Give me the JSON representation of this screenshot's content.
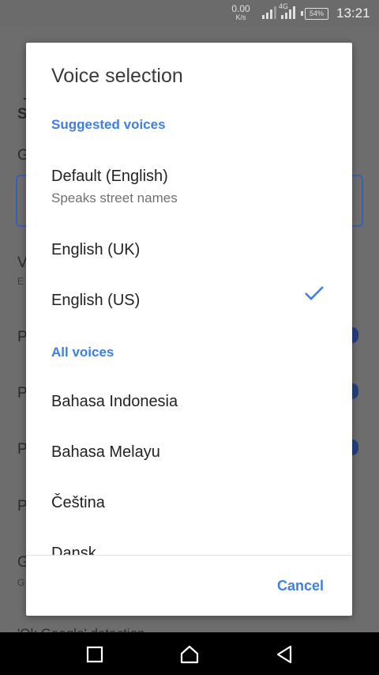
{
  "status_bar": {
    "net_speed": "0.00",
    "net_speed_unit": "K/s",
    "network_tag": "4G",
    "battery": "54%",
    "time": "13:21"
  },
  "background": {
    "section_initial": "S",
    "row1_initial": "G",
    "row2_initial": "V",
    "row2_sub_initial": "E",
    "row3_initial": "P",
    "row4_initial": "P",
    "row5_initial": "P",
    "row6_initial": "P",
    "row7_initial": "G",
    "row7_sub_initial": "G",
    "bottom_text": "'Ok Google' detection"
  },
  "dialog": {
    "title": "Voice selection",
    "suggested_header": "Suggested voices",
    "suggested": [
      {
        "label": "Default (English)",
        "sub": "Speaks street names"
      },
      {
        "label": "English (UK)"
      },
      {
        "label": "English (US)",
        "selected": true
      }
    ],
    "all_header": "All voices",
    "all": [
      {
        "label": "Bahasa Indonesia"
      },
      {
        "label": "Bahasa Melayu"
      },
      {
        "label": "Čeština"
      },
      {
        "label": "Dansk"
      }
    ],
    "cancel_label": "Cancel"
  },
  "colors": {
    "accent": "#3f7ee4",
    "scrim": "#6d6d6d"
  },
  "icons": {
    "selected": "checkmark-icon",
    "nav": [
      "recents-square-icon",
      "home-icon",
      "back-triangle-icon"
    ]
  }
}
